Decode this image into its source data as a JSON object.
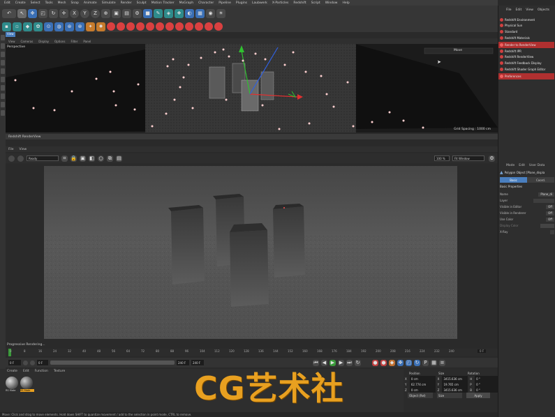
{
  "menubar": {
    "items": [
      "Edit",
      "Create",
      "Select",
      "Tools",
      "Mesh",
      "Snap",
      "Animate",
      "Simulate",
      "Render",
      "Sculpt",
      "Motion Tracker",
      "MoGraph",
      "Character",
      "Pipeline",
      "Plugins",
      "Laubwerk",
      "X-Particles",
      "Redshift",
      "Script",
      "Window",
      "Help"
    ]
  },
  "toolbar": {
    "axis_x": "X",
    "axis_y": "Y",
    "axis_z": "Z"
  },
  "viewport": {
    "tab": "View",
    "menu": [
      "View",
      "Cameras",
      "Display",
      "Options",
      "Filter",
      "Panel"
    ],
    "label": "Perspective",
    "grid_spacing": "Grid Spacing : 1000 cm",
    "move_label": "Move"
  },
  "renderview": {
    "title": "Redshift RenderView",
    "menu": [
      "File",
      "View"
    ],
    "status": "Ready",
    "zoom": "100 %",
    "fit": "Fit Window",
    "progress": "Progressive Rendering..."
  },
  "timeline": {
    "ticks": [
      "0",
      "8",
      "16",
      "24",
      "32",
      "40",
      "48",
      "56",
      "64",
      "72",
      "80",
      "88",
      "96",
      "104",
      "112",
      "120",
      "128",
      "136",
      "144",
      "152",
      "160",
      "168",
      "176",
      "184",
      "192",
      "200",
      "208",
      "216",
      "224",
      "232",
      "240"
    ],
    "end_label": "0 F",
    "start_field": "0 F",
    "min_field": "0 F",
    "max_field": "240 F",
    "end_field": "240 F"
  },
  "materials": {
    "menu": [
      "Create",
      "Edit",
      "Function",
      "Texture"
    ],
    "items": [
      {
        "label": "RS Mate"
      },
      {
        "label": "RS Mate"
      }
    ]
  },
  "coordinates": {
    "headers": [
      "Position",
      "Size",
      "Rotation"
    ],
    "rows": [
      {
        "axis": "X",
        "pos": "0 cm",
        "size": "3415.636 cm",
        "rot_axis": "H",
        "rot": "0 °"
      },
      {
        "axis": "Y",
        "pos": "62.774 cm",
        "size": "19.765 cm",
        "rot_axis": "P",
        "rot": "0 °"
      },
      {
        "axis": "Z",
        "pos": "0 cm",
        "size": "3415.636 cm",
        "rot_axis": "B",
        "rot": "0 °"
      }
    ],
    "mode": "Object (Rel)",
    "size_mode": "Size",
    "apply": "Apply"
  },
  "statusbar": "Move: Click and drag to move elements. Hold down SHIFT to quantize movement / add to the selection in point mode, CTRL to remove.",
  "redshift_menu": {
    "menu": [
      "File",
      "Edit",
      "View",
      "Objects"
    ],
    "items": [
      {
        "label": "Redshift Environment",
        "highlight": false
      },
      {
        "label": "Physical Sun",
        "highlight": false
      },
      {
        "label": "Standard",
        "highlight": false
      },
      {
        "label": "Redshift Materials",
        "highlight": false
      },
      {
        "label": "Render to RenderView",
        "highlight": true
      },
      {
        "label": "Redshift IPR",
        "highlight": false
      },
      {
        "label": "Redshift RenderView",
        "highlight": false
      },
      {
        "label": "Redshift Feedback Display",
        "highlight": false
      },
      {
        "label": "Redshift Shader Graph Editor",
        "highlight": false
      },
      {
        "label": "Preferences",
        "highlight": true
      }
    ]
  },
  "attributes": {
    "menu": [
      "Mode",
      "Edit",
      "User Data"
    ],
    "title": "Polygon Object [Plane_displa",
    "tabs": [
      "Basic",
      "Coord."
    ],
    "section": "Basic Properties",
    "rows": [
      {
        "label": "Name",
        "value": "Plane_di"
      },
      {
        "label": "Layer",
        "value": ""
      },
      {
        "label": "Visible in Editor",
        "value": "Off"
      },
      {
        "label": "Visible in Renderer",
        "value": "Off"
      },
      {
        "label": "Use Color",
        "value": "Off"
      },
      {
        "label": "Display Color",
        "value": ""
      },
      {
        "label": "X-Ray",
        "value": ""
      }
    ]
  },
  "watermark": "CG艺术社",
  "colors": {
    "accent_blue": "#4a7fbf",
    "redshift_red": "#d04040",
    "watermark": "#e8a020"
  }
}
